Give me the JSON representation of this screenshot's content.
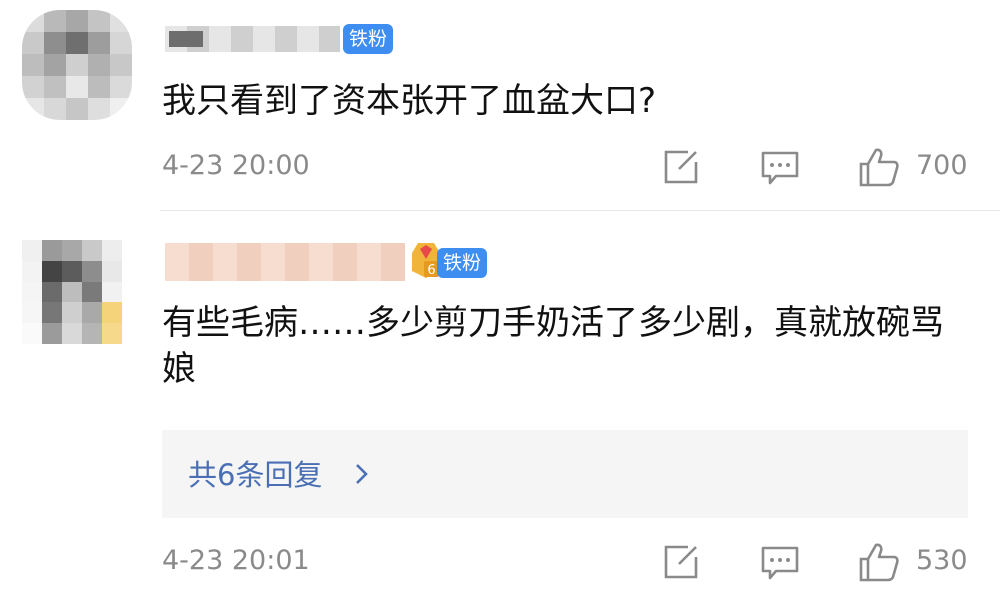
{
  "comments": [
    {
      "badge": "铁粉",
      "text": "我只看到了资本张开了血盆大口?",
      "time": "4-23 20:00",
      "likes": "700",
      "icons": [
        "share-icon",
        "comment-icon",
        "like-icon"
      ]
    },
    {
      "badge": "铁粉",
      "level": "6",
      "text": "有些毛病……多少剪刀手奶活了多少剧，真就放碗骂娘",
      "replies_label": "共6条回复",
      "time": "4-23 20:01",
      "likes": "530",
      "icons": [
        "share-icon",
        "comment-icon",
        "like-icon"
      ]
    }
  ],
  "colors": {
    "badge": "#3d8ef0",
    "link": "#4a6fb5",
    "meta": "#8a8a8a"
  }
}
